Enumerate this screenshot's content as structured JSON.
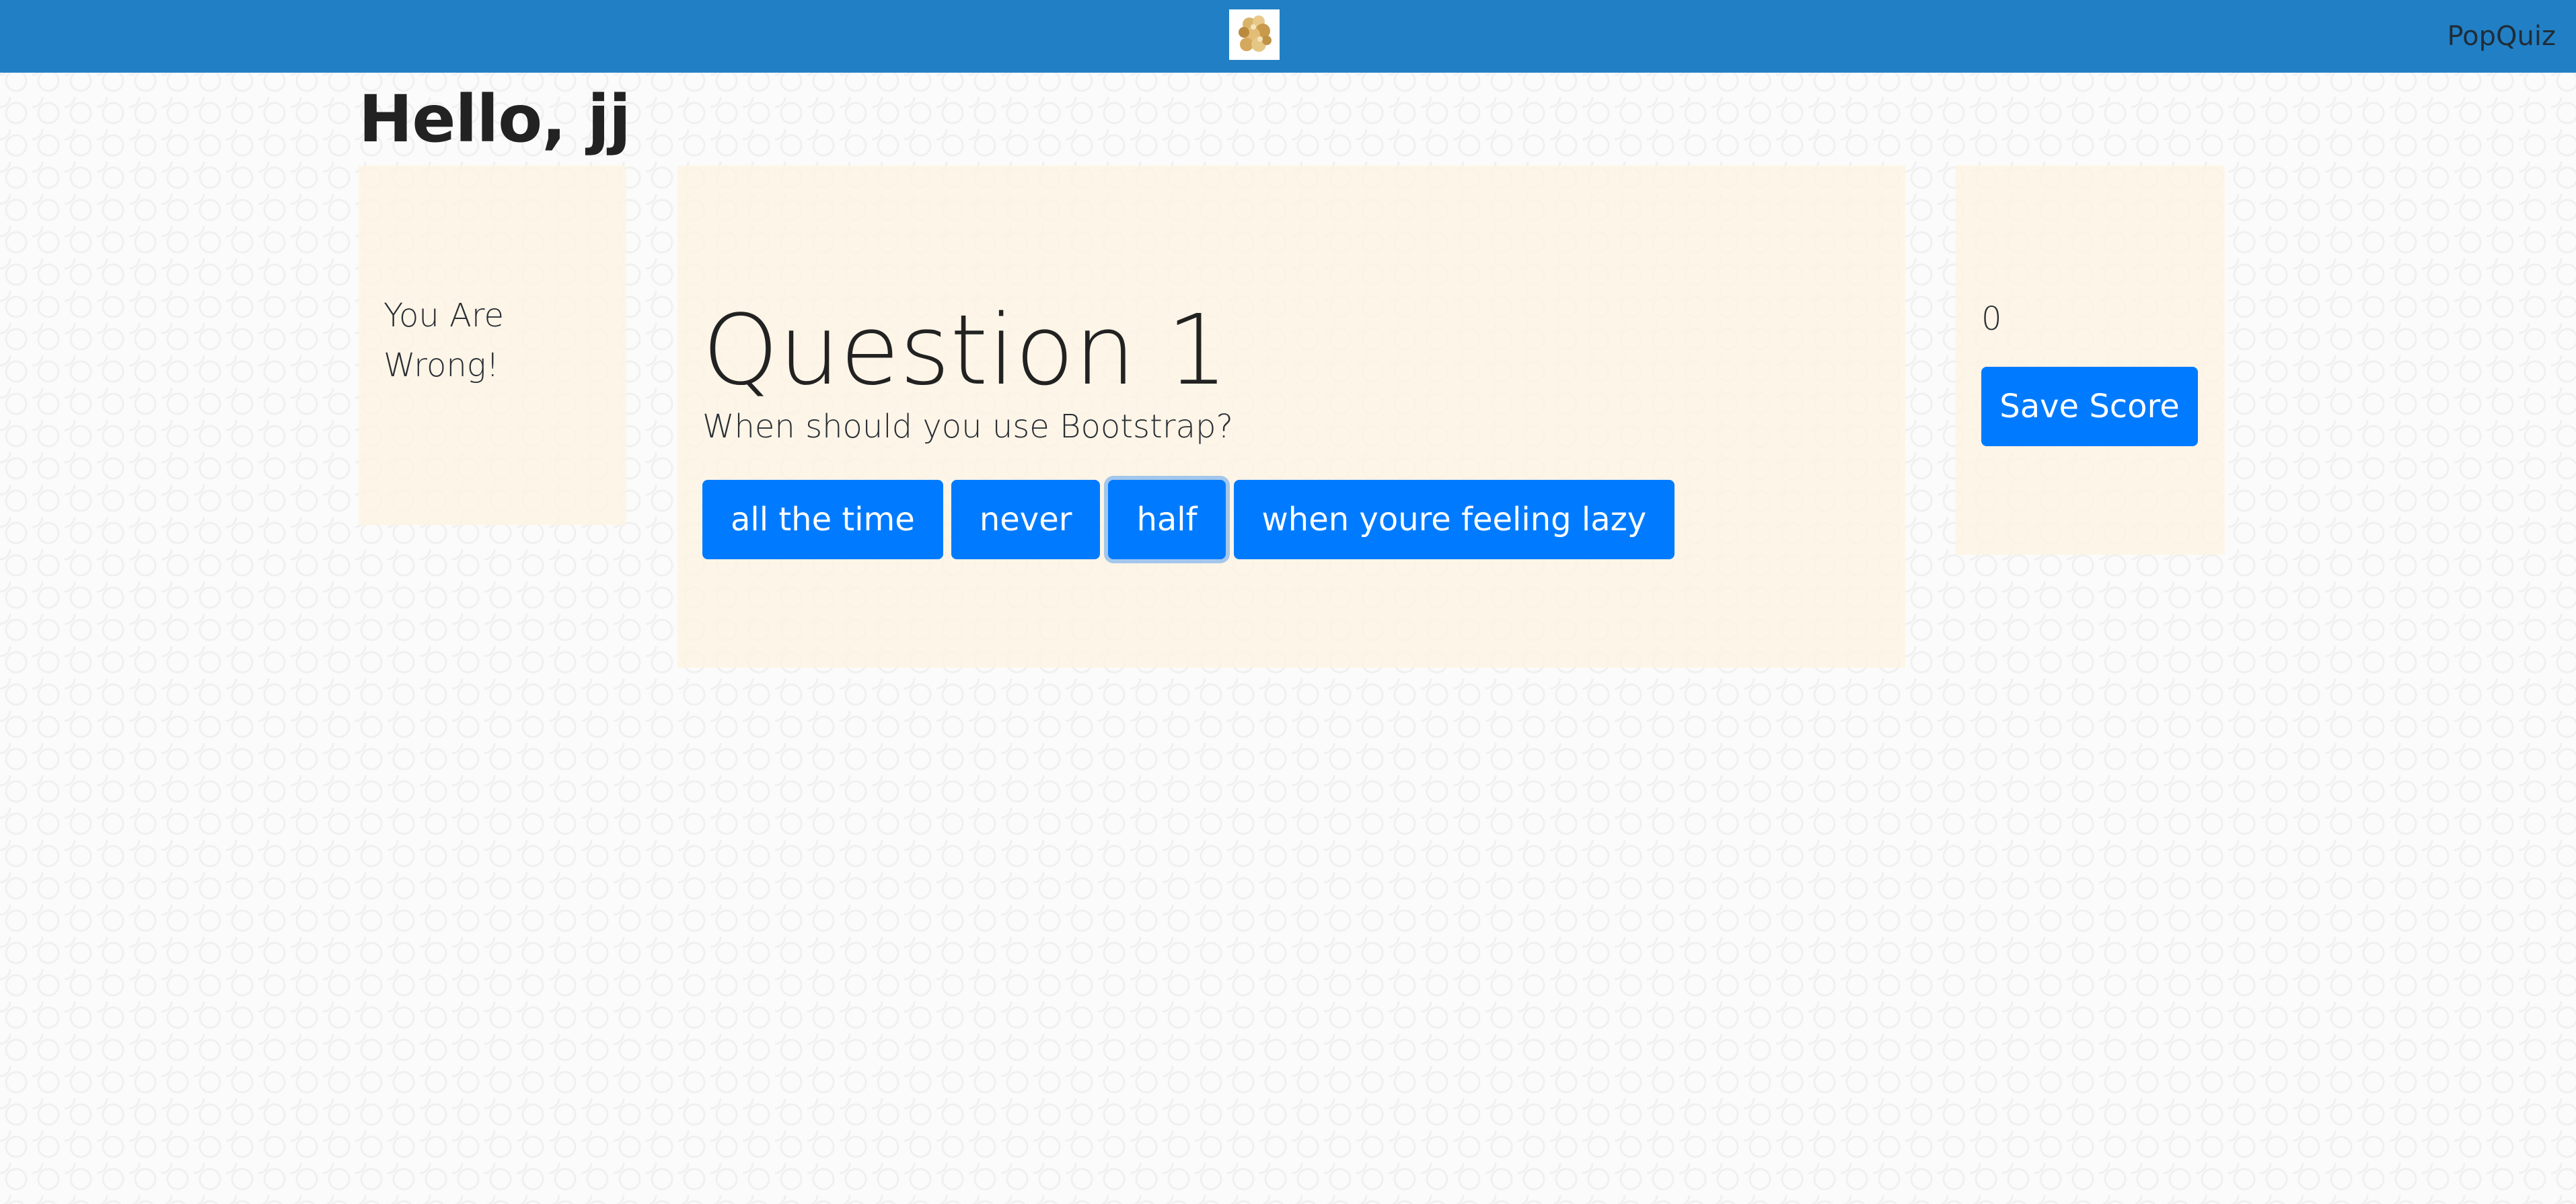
{
  "navbar": {
    "logo_icon": "popcorn-logo-icon",
    "brand": "PopQuiz",
    "background": "#2180c5"
  },
  "greeting": "Hello, jj",
  "feedback": {
    "message": "You Are Wrong!"
  },
  "quiz": {
    "title": "Question 1",
    "question": "When should you use Bootstrap?",
    "answers": [
      {
        "label": "all the time"
      },
      {
        "label": "never"
      },
      {
        "label": "half"
      },
      {
        "label": "when youre feeling lazy"
      }
    ],
    "focused_answer": "half"
  },
  "scoreboard": {
    "score": "0",
    "save_label": "Save Score"
  },
  "colors": {
    "primary_button": "#007bff",
    "panel": "#fdf3e2"
  }
}
